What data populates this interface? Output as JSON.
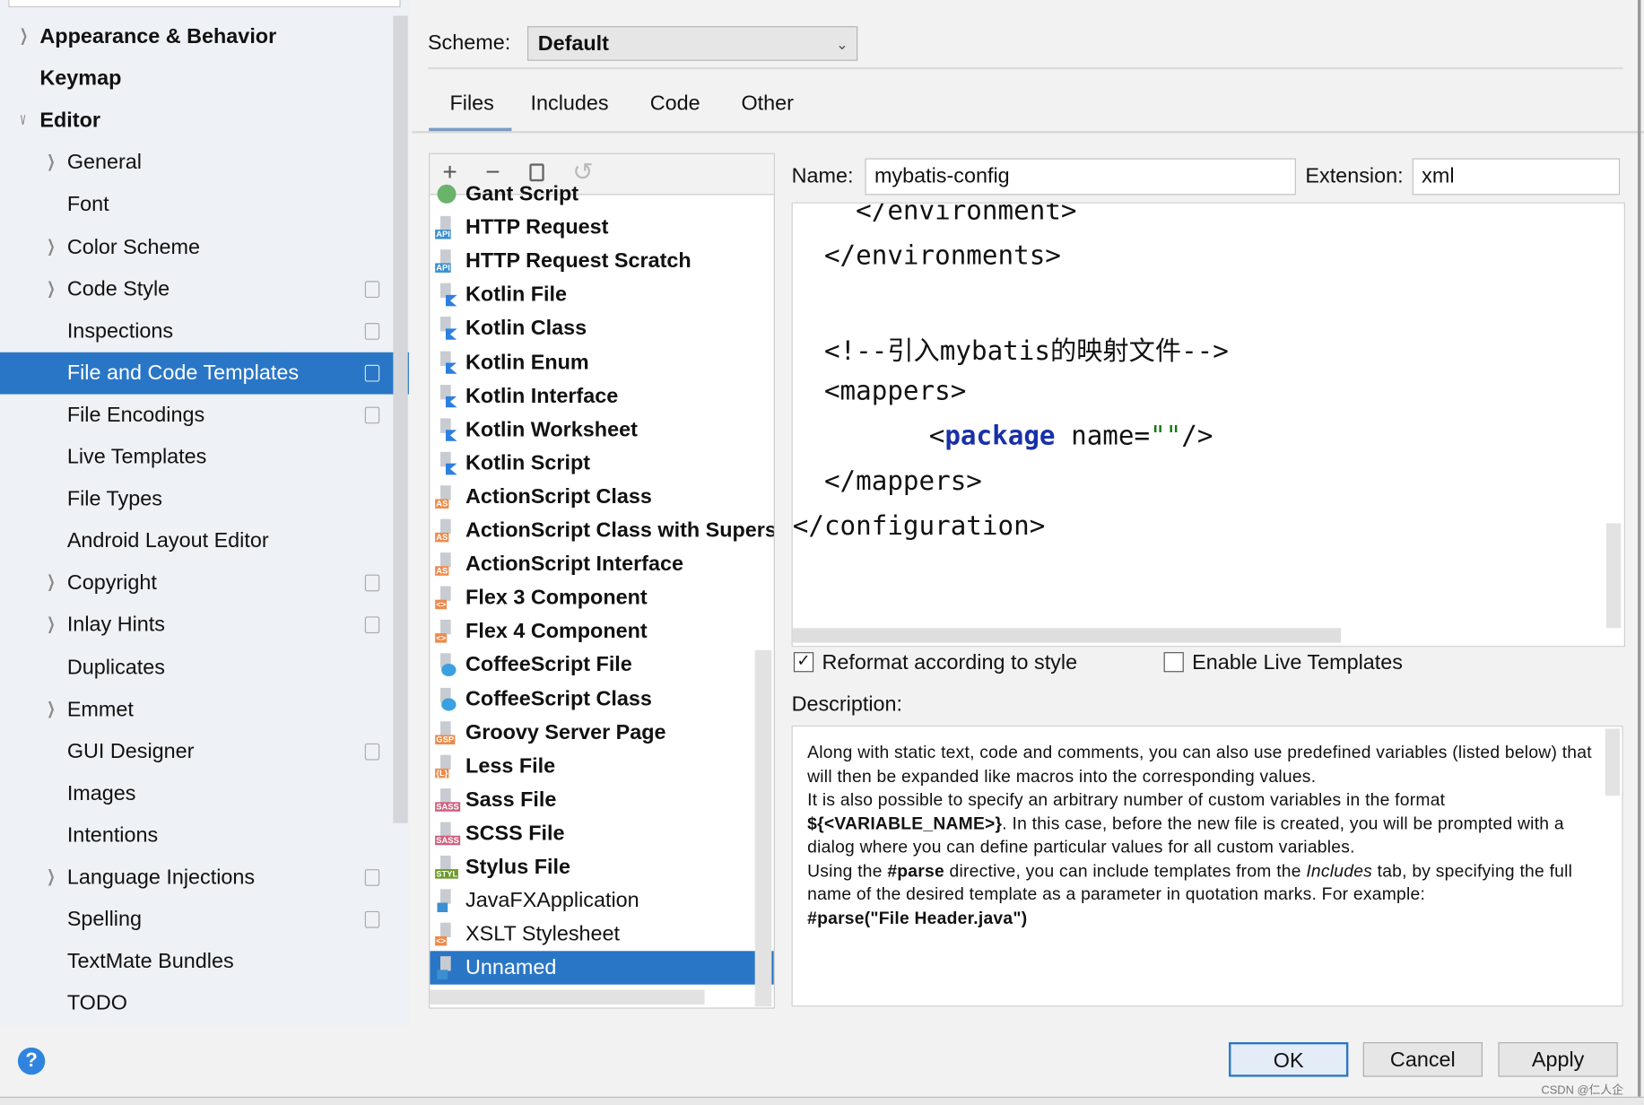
{
  "sidebar": {
    "items": [
      {
        "label": "Appearance & Behavior",
        "arrow": "›",
        "bold": true
      },
      {
        "label": "Keymap",
        "bold": true
      },
      {
        "label": "Editor",
        "arrow": "v",
        "bold": true
      },
      {
        "label": "General",
        "arrow": "›"
      },
      {
        "label": "Font"
      },
      {
        "label": "Color Scheme",
        "arrow": "›"
      },
      {
        "label": "Code Style",
        "arrow": "›",
        "copy": true
      },
      {
        "label": "Inspections",
        "copy": true
      },
      {
        "label": "File and Code Templates",
        "copy": true,
        "selected": true
      },
      {
        "label": "File Encodings",
        "copy": true
      },
      {
        "label": "Live Templates"
      },
      {
        "label": "File Types"
      },
      {
        "label": "Android Layout Editor"
      },
      {
        "label": "Copyright",
        "arrow": "›",
        "copy": true
      },
      {
        "label": "Inlay Hints",
        "arrow": "›",
        "copy": true
      },
      {
        "label": "Duplicates"
      },
      {
        "label": "Emmet",
        "arrow": "›"
      },
      {
        "label": "GUI Designer",
        "copy": true
      },
      {
        "label": "Images"
      },
      {
        "label": "Intentions"
      },
      {
        "label": "Language Injections",
        "arrow": "›",
        "copy": true
      },
      {
        "label": "Spelling",
        "copy": true
      },
      {
        "label": "TextMate Bundles"
      },
      {
        "label": "TODO"
      }
    ]
  },
  "scheme": {
    "label": "Scheme:",
    "value": "Default"
  },
  "tabs": [
    {
      "label": "Files",
      "active": true
    },
    {
      "label": "Includes"
    },
    {
      "label": "Code"
    },
    {
      "label": "Other"
    }
  ],
  "toolbar": {
    "add": "+",
    "remove": "−",
    "copy": "copy-icon",
    "reset": "reset-icon"
  },
  "templates": [
    {
      "label": "Gant Script",
      "icon": "gant",
      "bold": true
    },
    {
      "label": "HTTP Request",
      "icon": "API",
      "color": "#3c8fd0",
      "bold": true
    },
    {
      "label": "HTTP Request Scratch",
      "icon": "API",
      "color": "#3c8fd0",
      "bold": true
    },
    {
      "label": "Kotlin File",
      "icon": "K",
      "color": "#2d7fe0",
      "bold": true
    },
    {
      "label": "Kotlin Class",
      "icon": "K",
      "color": "#2d7fe0",
      "bold": true
    },
    {
      "label": "Kotlin Enum",
      "icon": "K",
      "color": "#2d7fe0",
      "bold": true
    },
    {
      "label": "Kotlin Interface",
      "icon": "K",
      "color": "#2d7fe0",
      "bold": true
    },
    {
      "label": "Kotlin Worksheet",
      "icon": "K",
      "color": "#2d7fe0",
      "bold": true
    },
    {
      "label": "Kotlin Script",
      "icon": "K",
      "color": "#2d7fe0",
      "bold": true
    },
    {
      "label": "ActionScript Class",
      "icon": "AS",
      "color": "#ee8a4a",
      "bold": true
    },
    {
      "label": "ActionScript Class with Supers",
      "icon": "AS",
      "color": "#ee8a4a",
      "bold": true
    },
    {
      "label": "ActionScript Interface",
      "icon": "AS",
      "color": "#ee8a4a",
      "bold": true
    },
    {
      "label": "Flex 3 Component",
      "icon": "<>",
      "color": "#ee8a4a",
      "bold": true
    },
    {
      "label": "Flex 4 Component",
      "icon": "<>",
      "color": "#ee8a4a",
      "bold": true
    },
    {
      "label": "CoffeeScript File",
      "icon": "coffee",
      "color": "#3aa0e0",
      "bold": true
    },
    {
      "label": "CoffeeScript Class",
      "icon": "coffee",
      "color": "#3aa0e0",
      "bold": true
    },
    {
      "label": "Groovy Server Page",
      "icon": "GSP",
      "color": "#ee8a4a",
      "bold": true
    },
    {
      "label": "Less File",
      "icon": "{L}",
      "color": "#ee8a4a",
      "bold": true
    },
    {
      "label": "Sass File",
      "icon": "SASS",
      "color": "#d06080",
      "bold": true
    },
    {
      "label": "SCSS File",
      "icon": "SASS",
      "color": "#d06080",
      "bold": true
    },
    {
      "label": "Stylus File",
      "icon": "STYL",
      "color": "#6a9a2a",
      "bold": true
    },
    {
      "label": "JavaFXApplication",
      "icon": "J",
      "color": "#3c8fd0"
    },
    {
      "label": "XSLT Stylesheet",
      "icon": "<>",
      "color": "#ee8a4a"
    },
    {
      "label": "Unnamed",
      "icon": "J",
      "color": "#3c8fd0",
      "selected": true
    }
  ],
  "name": {
    "label": "Name:",
    "value": "mybatis-config"
  },
  "extension": {
    "label": "Extension:",
    "value": "xml"
  },
  "code_lines": [
    "    </environment>",
    "  </environments>",
    "",
    "  <!--引入mybatis的映射文件-->",
    "  <mappers>",
    "    <package name=\"\"/>",
    "  </mappers>",
    "</configuration>"
  ],
  "code_parts": {
    "open": "<",
    "tag": "package",
    "attr": " name=",
    "str": "\"\"",
    "close": "/>"
  },
  "options": {
    "reformat": {
      "label": "Reformat according to style",
      "checked": true
    },
    "live": {
      "label": "Enable Live Templates",
      "checked": false
    }
  },
  "description": {
    "label": "Description:",
    "p1": "Along with static text, code and comments, you can also use predefined variables (listed below) that will then be expanded like macros into the corresponding values.",
    "p2a": "It is also possible to specify an arbitrary number of custom variables in the format ",
    "p2b": "${<VARIABLE_NAME>}",
    "p2c": ". In this case, before the new file is created, you will be prompted with a dialog where you can define particular values for all custom variables.",
    "p3a": "Using the ",
    "p3b": "#parse",
    "p3c": " directive, you can include templates from the ",
    "p3d": "Includes",
    "p3e": " tab, by specifying the full name of the desired template as a parameter in quotation marks. For example:",
    "p4": "#parse(\"File Header.java\")"
  },
  "buttons": {
    "ok": "OK",
    "cancel": "Cancel",
    "apply": "Apply",
    "help": "?"
  },
  "watermark": "CSDN @仁人企"
}
